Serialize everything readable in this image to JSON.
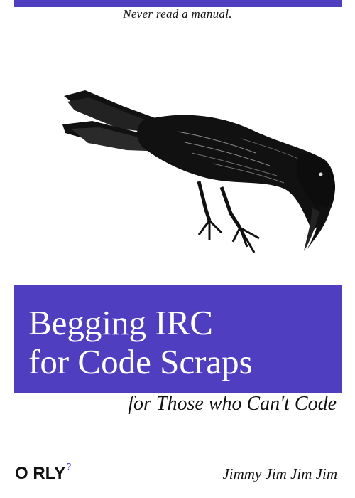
{
  "cover": {
    "tagline": "Never read a manual.",
    "title": "Begging IRC\nfor Code Scraps",
    "subtitle": "for Those who Can't Code",
    "publisher": "O RLY",
    "publisher_mark": "?",
    "author": "Jimmy Jim Jim Jim",
    "accent_color": "#4f3fc0",
    "illustration": "crow-icon"
  }
}
